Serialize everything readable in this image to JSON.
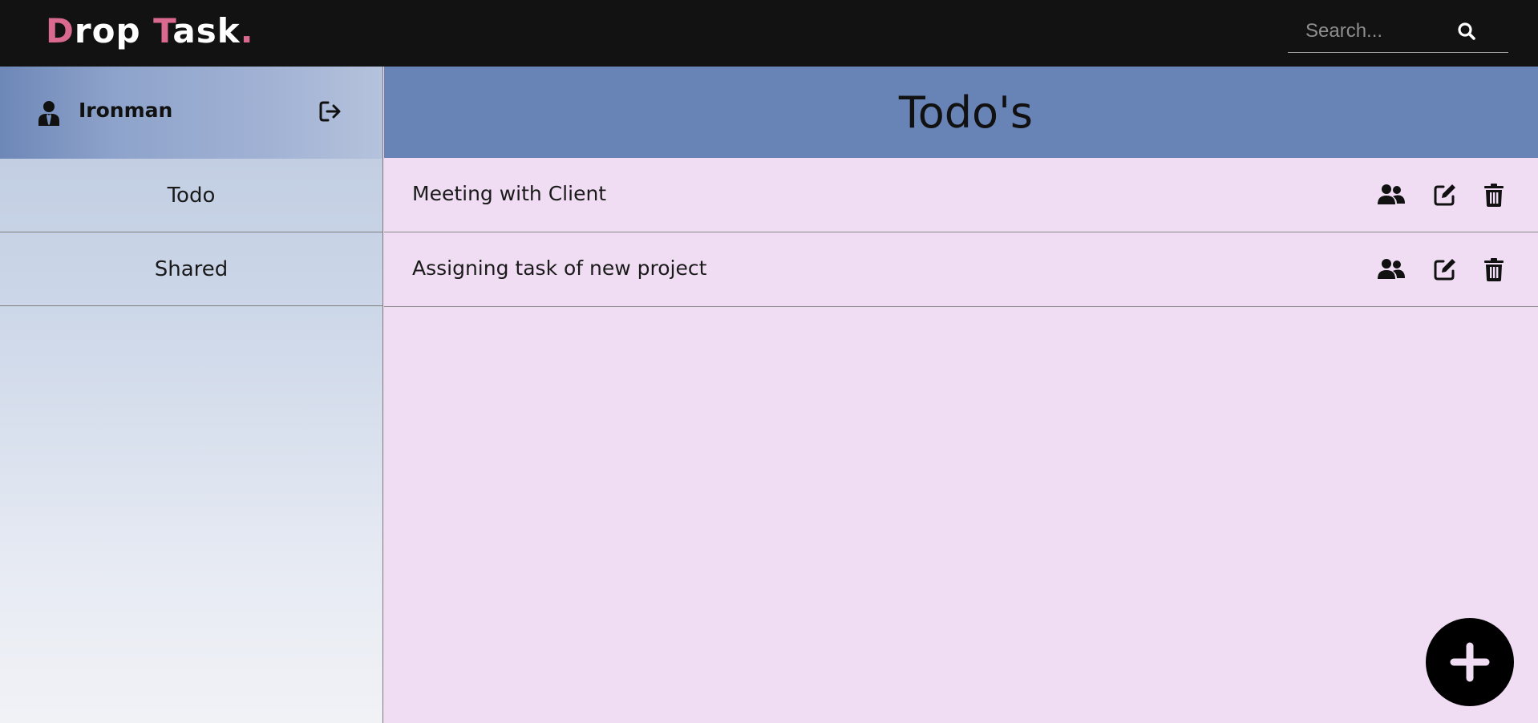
{
  "app": {
    "logo_part1_accent": "D",
    "logo_part1_rest": "rop",
    "logo_part2_accent": "T",
    "logo_part2_rest": "ask",
    "logo_dot": "."
  },
  "search": {
    "placeholder": "Search...",
    "value": "",
    "icon": "search-icon"
  },
  "sidebar": {
    "user_name": "Ironman",
    "user_icon": "user-tie-icon",
    "logout_icon": "sign-out-icon",
    "items": [
      {
        "label": "Todo"
      },
      {
        "label": "Shared"
      }
    ]
  },
  "main": {
    "title": "Todo's",
    "todos": [
      {
        "text": "Meeting with Client"
      },
      {
        "text": "Assigning task of new project"
      }
    ],
    "row_icons": [
      "users-icon",
      "edit-icon",
      "trash-icon"
    ],
    "fab_icon": "plus-icon"
  },
  "colors": {
    "topbar": "#121212",
    "logo_accent": "#d9698f",
    "header": "#6884b6",
    "content_bg": "#f0ddf3",
    "sidebar_bg": "#c5d1e5"
  }
}
